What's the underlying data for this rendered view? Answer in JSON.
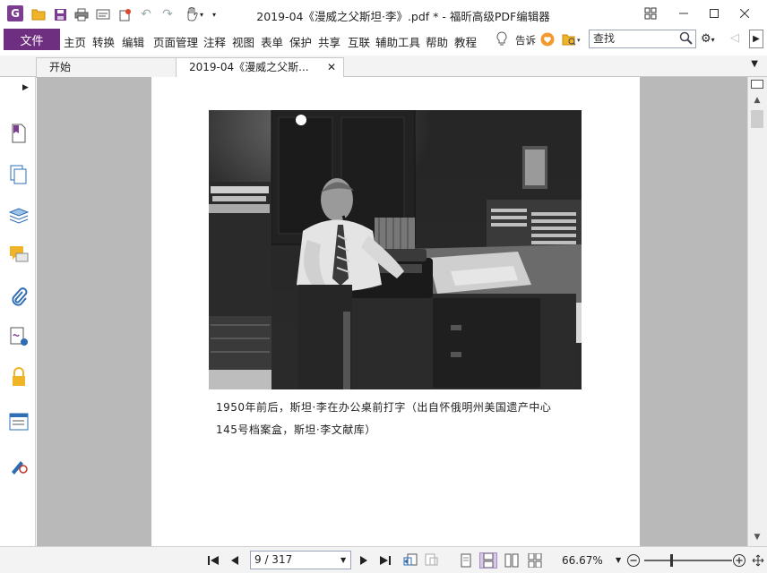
{
  "window": {
    "title": "2019-04《漫威之父斯坦·李》.pdf * - 福昕高级PDF编辑器",
    "controls": [
      "restore-icon",
      "minimize-icon",
      "maximize-icon",
      "close-icon"
    ]
  },
  "quick_access": [
    "open-folder-icon",
    "save-icon",
    "print-icon",
    "scan-icon",
    "new-icon",
    "undo-icon",
    "redo-icon",
    "hand-tool-icon"
  ],
  "menu": {
    "file": "文件",
    "items": [
      "主页",
      "转换",
      "编辑",
      "页面管理",
      "注释",
      "视图",
      "表单",
      "保护",
      "共享",
      "互联",
      "辅助工具",
      "帮助",
      "教程"
    ],
    "tell_me": "告诉",
    "search_placeholder": "查找"
  },
  "tabs": [
    {
      "label": "开始",
      "active": false
    },
    {
      "label": "2019-04《漫威之父斯...",
      "active": true
    }
  ],
  "sidebar": [
    "bookmark-icon",
    "pages-icon",
    "layers-icon",
    "comments-icon",
    "attachments-icon",
    "signatures-icon",
    "security-icon",
    "fields-icon",
    "certify-icon"
  ],
  "document": {
    "caption_line1": "1950年前后，斯坦·李在办公桌前打字（出自怀俄明州美国遗产中心",
    "caption_line2": "145号档案盒，斯坦·李文献库）"
  },
  "statusbar": {
    "page_indicator": "9 / 317",
    "zoom": "66.67%",
    "zoom_level": 0.3
  },
  "colors": {
    "accent": "#6f2f80",
    "doc_background": "#b9b9b9"
  }
}
